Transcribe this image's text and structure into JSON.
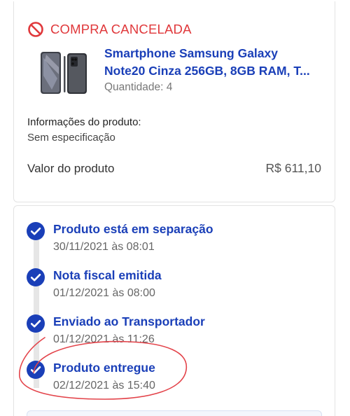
{
  "order": {
    "status": "COMPRA CANCELADA",
    "status_icon": "ban-icon",
    "status_color": "#e0383b"
  },
  "product": {
    "name_line1": "Smartphone Samsung Galaxy",
    "name_line2": "Note20 Cinza 256GB, 8GB RAM, T...",
    "quantity": "Quantidade: 4",
    "info_title": "Informações do produto:",
    "info_value": "Sem especificação",
    "price_label": "Valor do produto",
    "price_value": "R$ 611,10"
  },
  "timeline": [
    {
      "title": "Produto está em separação",
      "date": "30/11/2021 às 08:01"
    },
    {
      "title": "Nota fiscal emitida",
      "date": "01/12/2021 às 08:00"
    },
    {
      "title": "Enviado ao Transportador",
      "date": "01/12/2021 às 11:26"
    },
    {
      "title": "Produto entregue",
      "date": "02/12/2021 às 15:40"
    }
  ],
  "colors": {
    "accent": "#1a3fb8",
    "check": "#1a3fb8",
    "annotation": "#e3434a"
  }
}
